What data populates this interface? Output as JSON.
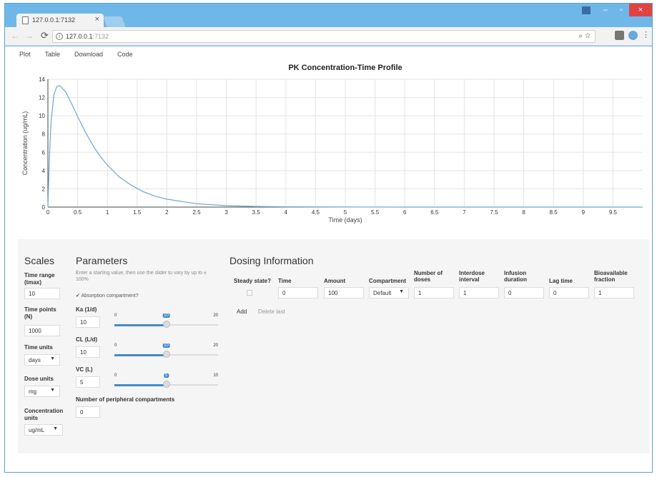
{
  "browser": {
    "tab_title": "127.0.0.1:7132",
    "url_host": "127.0.0.1",
    "url_port": ":7132",
    "window_close": "×",
    "window_min": "–",
    "window_max": "▫"
  },
  "nav": {
    "tabs": [
      "Plot",
      "Table",
      "Download",
      "Code"
    ]
  },
  "chart_data": {
    "type": "line",
    "title": "PK Concentration-Time Profile",
    "xlabel": "Time (days)",
    "ylabel": "Concentration (ug/mL)",
    "xlim": [
      0,
      10
    ],
    "ylim": [
      0,
      14
    ],
    "xticks": [
      0,
      0.5,
      1,
      1.5,
      2,
      2.5,
      3,
      3.5,
      4,
      4.5,
      5,
      5.5,
      6,
      6.5,
      7,
      7.5,
      8,
      8.5,
      9,
      9.5
    ],
    "yticks": [
      0,
      2,
      4,
      6,
      8,
      10,
      12,
      14
    ],
    "grid": true,
    "series": [
      {
        "color": "#6aa9c9",
        "x": [
          0,
          0.02,
          0.05,
          0.1,
          0.15,
          0.2,
          0.3,
          0.4,
          0.5,
          0.6,
          0.7,
          0.8,
          0.9,
          1.0,
          1.2,
          1.4,
          1.6,
          1.8,
          2.0,
          2.5,
          3.0,
          3.5,
          4.0,
          5.0,
          6.0,
          7.0,
          8.0,
          9.0,
          10.0
        ],
        "y": [
          0,
          4.5,
          9.1,
          12.3,
          13.2,
          13.3,
          12.6,
          11.3,
          9.9,
          8.6,
          7.4,
          6.3,
          5.4,
          4.6,
          3.3,
          2.4,
          1.7,
          1.2,
          0.87,
          0.37,
          0.16,
          0.07,
          0.03,
          0.01,
          0.0,
          0.0,
          0.0,
          0.0,
          0.0
        ]
      }
    ]
  },
  "scales": {
    "heading": "Scales",
    "time_range_label": "Time range (tmax)",
    "time_range_value": "10",
    "time_points_label": "Time points (N)",
    "time_points_value": "1000",
    "time_units_label": "Time units",
    "time_units_value": "days",
    "dose_units_label": "Dose units",
    "dose_units_value": "mg",
    "conc_units_label": "Concentration units",
    "conc_units_value": "ug/mL"
  },
  "parameters": {
    "heading": "Parameters",
    "help_text": "Enter a starting value, then use the slider to vary by up to ± 100%",
    "absorption_label": "Absorption compartment?",
    "ka_label": "Ka (1/d)",
    "ka_value": "10",
    "ka_min": "0",
    "ka_max": "20",
    "ka_current": 10,
    "cl_label": "CL (L/d)",
    "cl_value": "10",
    "cl_min": "0",
    "cl_max": "20",
    "cl_current": 10,
    "vc_label": "VC (L)",
    "vc_value": "5",
    "vc_min": "0",
    "vc_max": "10",
    "vc_current": 5,
    "periph_label": "Number of peripheral compartments",
    "periph_value": "0"
  },
  "dosing": {
    "heading": "Dosing Information",
    "headers": {
      "steady": "Steady state?",
      "time": "Time",
      "amount": "Amount",
      "compartment": "Compartment",
      "ndoses": "Number of doses",
      "interval": "Interdose interval",
      "infusion": "Infusion duration",
      "lag": "Lag time",
      "bio": "Bioavailable fraction"
    },
    "row": {
      "time": "0",
      "amount": "100",
      "compartment": "Default",
      "ndoses": "1",
      "interval": "1",
      "infusion": "0",
      "lag": "0",
      "bio": "1"
    },
    "add_label": "Add",
    "delete_label": "Delete last"
  }
}
